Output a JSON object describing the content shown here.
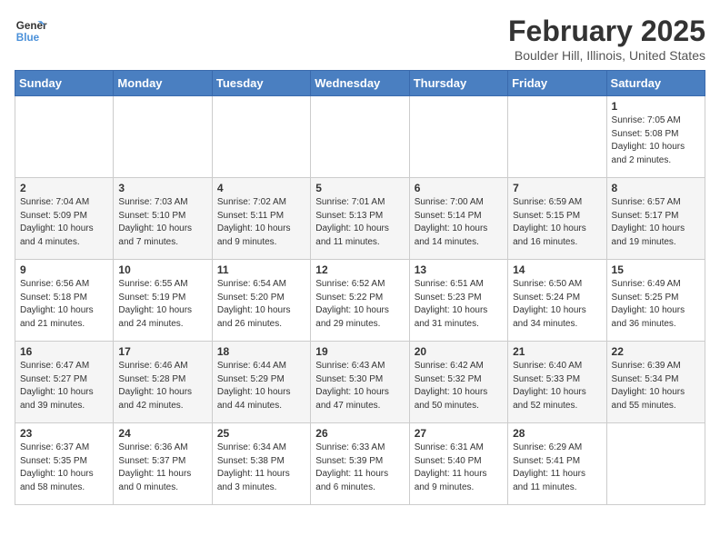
{
  "header": {
    "logo_line1": "General",
    "logo_line2": "Blue",
    "title": "February 2025",
    "subtitle": "Boulder Hill, Illinois, United States"
  },
  "days_of_week": [
    "Sunday",
    "Monday",
    "Tuesday",
    "Wednesday",
    "Thursday",
    "Friday",
    "Saturday"
  ],
  "weeks": [
    [
      {
        "day": "",
        "text": ""
      },
      {
        "day": "",
        "text": ""
      },
      {
        "day": "",
        "text": ""
      },
      {
        "day": "",
        "text": ""
      },
      {
        "day": "",
        "text": ""
      },
      {
        "day": "",
        "text": ""
      },
      {
        "day": "1",
        "text": "Sunrise: 7:05 AM\nSunset: 5:08 PM\nDaylight: 10 hours\nand 2 minutes."
      }
    ],
    [
      {
        "day": "2",
        "text": "Sunrise: 7:04 AM\nSunset: 5:09 PM\nDaylight: 10 hours\nand 4 minutes."
      },
      {
        "day": "3",
        "text": "Sunrise: 7:03 AM\nSunset: 5:10 PM\nDaylight: 10 hours\nand 7 minutes."
      },
      {
        "day": "4",
        "text": "Sunrise: 7:02 AM\nSunset: 5:11 PM\nDaylight: 10 hours\nand 9 minutes."
      },
      {
        "day": "5",
        "text": "Sunrise: 7:01 AM\nSunset: 5:13 PM\nDaylight: 10 hours\nand 11 minutes."
      },
      {
        "day": "6",
        "text": "Sunrise: 7:00 AM\nSunset: 5:14 PM\nDaylight: 10 hours\nand 14 minutes."
      },
      {
        "day": "7",
        "text": "Sunrise: 6:59 AM\nSunset: 5:15 PM\nDaylight: 10 hours\nand 16 minutes."
      },
      {
        "day": "8",
        "text": "Sunrise: 6:57 AM\nSunset: 5:17 PM\nDaylight: 10 hours\nand 19 minutes."
      }
    ],
    [
      {
        "day": "9",
        "text": "Sunrise: 6:56 AM\nSunset: 5:18 PM\nDaylight: 10 hours\nand 21 minutes."
      },
      {
        "day": "10",
        "text": "Sunrise: 6:55 AM\nSunset: 5:19 PM\nDaylight: 10 hours\nand 24 minutes."
      },
      {
        "day": "11",
        "text": "Sunrise: 6:54 AM\nSunset: 5:20 PM\nDaylight: 10 hours\nand 26 minutes."
      },
      {
        "day": "12",
        "text": "Sunrise: 6:52 AM\nSunset: 5:22 PM\nDaylight: 10 hours\nand 29 minutes."
      },
      {
        "day": "13",
        "text": "Sunrise: 6:51 AM\nSunset: 5:23 PM\nDaylight: 10 hours\nand 31 minutes."
      },
      {
        "day": "14",
        "text": "Sunrise: 6:50 AM\nSunset: 5:24 PM\nDaylight: 10 hours\nand 34 minutes."
      },
      {
        "day": "15",
        "text": "Sunrise: 6:49 AM\nSunset: 5:25 PM\nDaylight: 10 hours\nand 36 minutes."
      }
    ],
    [
      {
        "day": "16",
        "text": "Sunrise: 6:47 AM\nSunset: 5:27 PM\nDaylight: 10 hours\nand 39 minutes."
      },
      {
        "day": "17",
        "text": "Sunrise: 6:46 AM\nSunset: 5:28 PM\nDaylight: 10 hours\nand 42 minutes."
      },
      {
        "day": "18",
        "text": "Sunrise: 6:44 AM\nSunset: 5:29 PM\nDaylight: 10 hours\nand 44 minutes."
      },
      {
        "day": "19",
        "text": "Sunrise: 6:43 AM\nSunset: 5:30 PM\nDaylight: 10 hours\nand 47 minutes."
      },
      {
        "day": "20",
        "text": "Sunrise: 6:42 AM\nSunset: 5:32 PM\nDaylight: 10 hours\nand 50 minutes."
      },
      {
        "day": "21",
        "text": "Sunrise: 6:40 AM\nSunset: 5:33 PM\nDaylight: 10 hours\nand 52 minutes."
      },
      {
        "day": "22",
        "text": "Sunrise: 6:39 AM\nSunset: 5:34 PM\nDaylight: 10 hours\nand 55 minutes."
      }
    ],
    [
      {
        "day": "23",
        "text": "Sunrise: 6:37 AM\nSunset: 5:35 PM\nDaylight: 10 hours\nand 58 minutes."
      },
      {
        "day": "24",
        "text": "Sunrise: 6:36 AM\nSunset: 5:37 PM\nDaylight: 11 hours\nand 0 minutes."
      },
      {
        "day": "25",
        "text": "Sunrise: 6:34 AM\nSunset: 5:38 PM\nDaylight: 11 hours\nand 3 minutes."
      },
      {
        "day": "26",
        "text": "Sunrise: 6:33 AM\nSunset: 5:39 PM\nDaylight: 11 hours\nand 6 minutes."
      },
      {
        "day": "27",
        "text": "Sunrise: 6:31 AM\nSunset: 5:40 PM\nDaylight: 11 hours\nand 9 minutes."
      },
      {
        "day": "28",
        "text": "Sunrise: 6:29 AM\nSunset: 5:41 PM\nDaylight: 11 hours\nand 11 minutes."
      },
      {
        "day": "",
        "text": ""
      }
    ]
  ]
}
